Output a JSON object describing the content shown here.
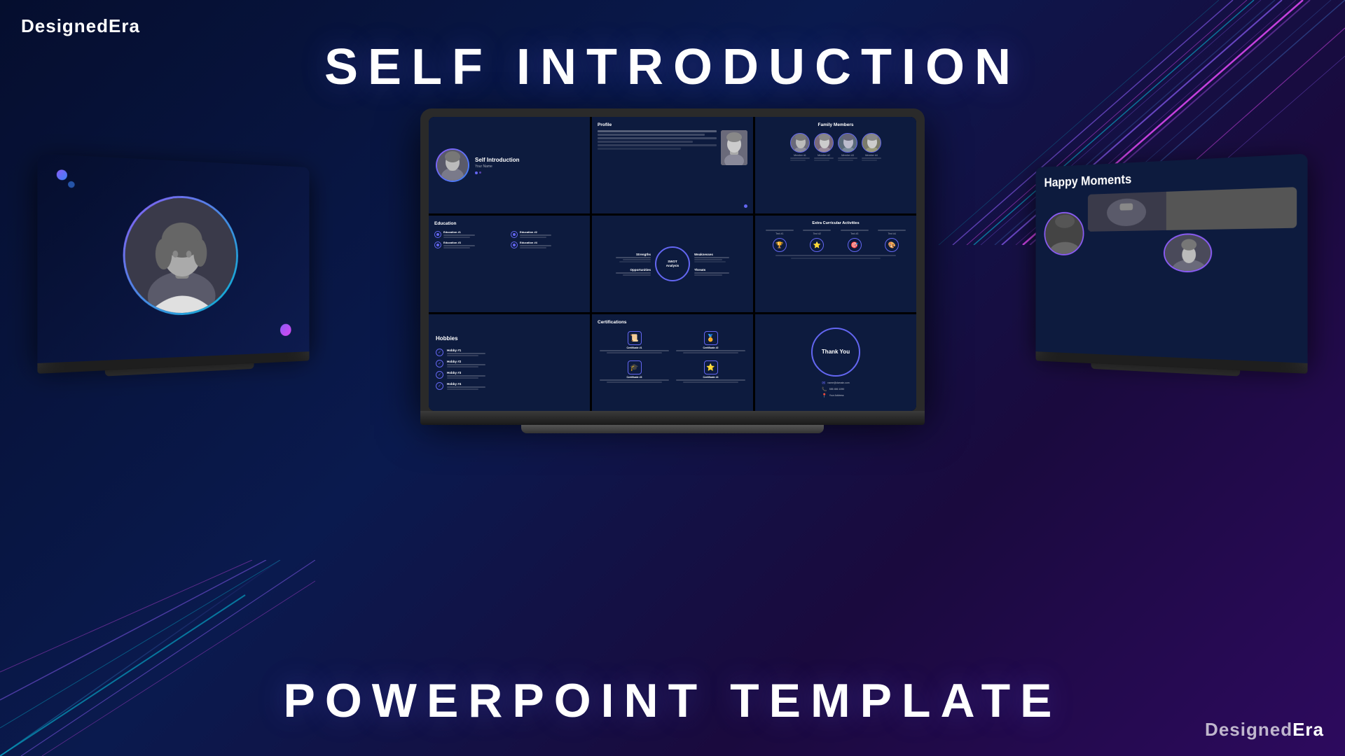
{
  "brand": {
    "name_light": "Designed",
    "name_bold": "Era",
    "full": "DesignedEra"
  },
  "main_title": "SELF INTRODUCTION",
  "bottom_title": "POWERPOINT TEMPLATE",
  "colors": {
    "bg_dark": "#050e2e",
    "accent_purple": "#8b5cf6",
    "accent_blue": "#3b82f6",
    "accent_cyan": "#06b6d4",
    "accent_magenta": "#d946ef",
    "slide_bg": "#0d1b3e",
    "text_white": "#ffffff",
    "text_muted": "rgba(255,255,255,0.5)"
  },
  "slides": [
    {
      "id": "self-intro",
      "title": "Self Introduction",
      "subtitle": "Your Name",
      "type": "intro"
    },
    {
      "id": "profile",
      "title": "Profile",
      "type": "profile"
    },
    {
      "id": "family",
      "title": "Family Members",
      "members": [
        "Member #1",
        "Member #2",
        "Member #3",
        "Member #4"
      ],
      "type": "family"
    },
    {
      "id": "education",
      "title": "Education",
      "items": [
        "Education #1",
        "Education #2",
        "Education #3",
        "Education #4"
      ],
      "type": "education"
    },
    {
      "id": "swot",
      "title": "SWOT Analysis",
      "quadrants": [
        "Strengths",
        "Weaknesses",
        "Opportunities",
        "Threats"
      ],
      "type": "swot"
    },
    {
      "id": "extra",
      "title": "Extra Curricular Activities",
      "items": [
        "Text #1",
        "Text #2",
        "Text #3",
        "Text #4"
      ],
      "type": "extra"
    },
    {
      "id": "hobbies",
      "title": "Hobbies",
      "items": [
        "Hobby #1",
        "Hobby #2",
        "Hobby #3",
        "Hobby #4"
      ],
      "type": "hobbies"
    },
    {
      "id": "certifications",
      "title": "Certifications",
      "items": [
        "Certificate #1",
        "Certificate #2",
        "Certificate #3",
        "Certificate #4"
      ],
      "type": "certifications"
    },
    {
      "id": "thankyou",
      "title": "Thank You",
      "type": "thankyou",
      "contact": {
        "email": "name@domain.com",
        "phone": "555 456 1090",
        "address": "Your Address"
      }
    }
  ],
  "left_slide": {
    "type": "portrait",
    "person_name": ""
  },
  "right_slide": {
    "title": "Happy Moments",
    "type": "moments"
  }
}
